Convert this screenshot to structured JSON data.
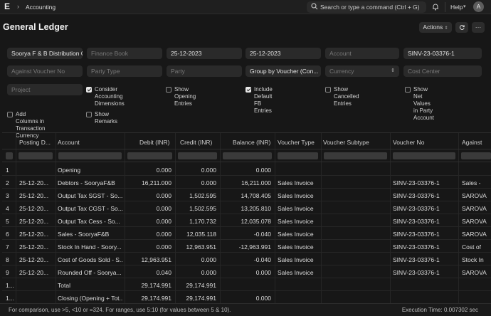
{
  "topbar": {
    "breadcrumb": "Accounting",
    "search_placeholder": "Search or type a command (Ctrl + G)",
    "help_label": "Help",
    "avatar_initial": "A"
  },
  "page": {
    "title": "General Ledger",
    "actions_label": "Actions"
  },
  "filters": {
    "company": "Soorya F & B Distribution C",
    "finance_book": "Finance Book",
    "from_date": "25-12-2023",
    "to_date": "25-12-2023",
    "account": "Account",
    "voucher_no": "SINV-23-03376-1",
    "against_voucher_no": "Against Voucher No",
    "party_type": "Party Type",
    "party": "Party",
    "group_by": "Group by Voucher (Con...",
    "currency": "Currency",
    "cost_center": "Cost Center",
    "project": "Project"
  },
  "checkboxes": {
    "consider_dims": {
      "label_1": "Consider Accounting",
      "label_2": "Dimensions",
      "checked": true
    },
    "opening": {
      "label": "Show Opening Entries",
      "checked": false
    },
    "include_fb": {
      "label": "Include Default FB Entries",
      "checked": true
    },
    "cancelled": {
      "label": "Show Cancelled Entries",
      "checked": false
    },
    "net_values": {
      "label_1": "Show Net Values in Party",
      "label_2": "Account",
      "checked": false
    },
    "add_cols": {
      "label_1": "Add Columns in",
      "label_2": "Transaction Currency",
      "checked": false
    },
    "remarks": {
      "label": "Show Remarks",
      "checked": false
    }
  },
  "table": {
    "columns": [
      "Posting D...",
      "Account",
      "Debit (INR)",
      "Credit (INR)",
      "Balance (INR)",
      "Voucher Type",
      "Voucher Subtype",
      "Voucher No",
      "Against"
    ],
    "rows": [
      {
        "n": "1",
        "date": "",
        "account": "Opening",
        "debit": "0.000",
        "credit": "0.000",
        "balance": "0.000",
        "vtype": "",
        "vno": "",
        "against": ""
      },
      {
        "n": "2",
        "date": "25-12-20...",
        "account": "Debtors - SooryaF&B",
        "debit": "16,211.000",
        "credit": "0.000",
        "balance": "16,211.000",
        "vtype": "Sales Invoice",
        "vno": "SINV-23-03376-1",
        "against": "Sales -"
      },
      {
        "n": "3",
        "date": "25-12-20...",
        "account": "Output Tax SGST - So...",
        "debit": "0.000",
        "credit": "1,502.595",
        "balance": "14,708.405",
        "vtype": "Sales Invoice",
        "vno": "SINV-23-03376-1",
        "against": "SAROVA"
      },
      {
        "n": "4",
        "date": "25-12-20...",
        "account": "Output Tax CGST - So...",
        "debit": "0.000",
        "credit": "1,502.595",
        "balance": "13,205.810",
        "vtype": "Sales Invoice",
        "vno": "SINV-23-03376-1",
        "against": "SAROVA"
      },
      {
        "n": "5",
        "date": "25-12-20...",
        "account": "Output Tax Cess - So...",
        "debit": "0.000",
        "credit": "1,170.732",
        "balance": "12,035.078",
        "vtype": "Sales Invoice",
        "vno": "SINV-23-03376-1",
        "against": "SAROVA"
      },
      {
        "n": "6",
        "date": "25-12-20...",
        "account": "Sales - SooryaF&B",
        "debit": "0.000",
        "credit": "12,035.118",
        "balance": "-0.040",
        "vtype": "Sales Invoice",
        "vno": "SINV-23-03376-1",
        "against": "SAROVA"
      },
      {
        "n": "7",
        "date": "25-12-20...",
        "account": "Stock In Hand - Soory...",
        "debit": "0.000",
        "credit": "12,963.951",
        "balance": "-12,963.991",
        "vtype": "Sales Invoice",
        "vno": "SINV-23-03376-1",
        "against": "Cost of"
      },
      {
        "n": "8",
        "date": "25-12-20...",
        "account": "Cost of Goods Sold - S...",
        "debit": "12,963.951",
        "credit": "0.000",
        "balance": "-0.040",
        "vtype": "Sales Invoice",
        "vno": "SINV-23-03376-1",
        "against": "Stock In"
      },
      {
        "n": "9",
        "date": "25-12-20...",
        "account": "Rounded Off - Soorya...",
        "debit": "0.040",
        "credit": "0.000",
        "balance": "0.000",
        "vtype": "Sales Invoice",
        "vno": "SINV-23-03376-1",
        "against": "SAROVA"
      },
      {
        "n": "1...",
        "date": "",
        "account": "Total",
        "debit": "29,174.991",
        "credit": "29,174.991",
        "balance": "",
        "vtype": "",
        "vno": "",
        "against": ""
      },
      {
        "n": "1...",
        "date": "",
        "account": "Closing (Opening + Tot...",
        "debit": "29,174.991",
        "credit": "29,174.991",
        "balance": "0.000",
        "vtype": "",
        "vno": "",
        "against": ""
      }
    ]
  },
  "footer": {
    "hint": "For comparison, use >5, <10 or =324. For ranges, use 5:10 (for values between 5 & 10).",
    "exec_time": "Execution Time: 0.007302 sec"
  }
}
